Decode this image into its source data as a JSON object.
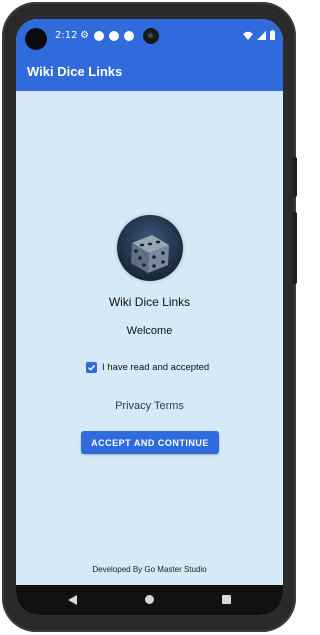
{
  "status_bar": {
    "time": "2:12",
    "icons": [
      "gear-icon",
      "notification-dot-icon",
      "notification-dot-icon",
      "notification-dot-icon",
      "wifi-icon",
      "signal-icon",
      "battery-icon"
    ]
  },
  "app_bar": {
    "title": "Wiki Dice Links"
  },
  "main": {
    "logo_icon": "dice-icon",
    "app_name": "Wiki Dice Links",
    "welcome_text": "Welcome",
    "consent_checkbox": {
      "checked": true,
      "label": "I have read and accepted"
    },
    "privacy_terms_link": "Privacy Terms",
    "accept_button_label": "ACCEPT AND CONTINUE",
    "footer": "Developed By Go Master Studio"
  },
  "nav_bar": {
    "icons": [
      "back-icon",
      "home-icon",
      "recents-icon"
    ]
  },
  "colors": {
    "primary": "#2f6bdc",
    "background": "#d6e9f7",
    "nav_bar": "#111111"
  }
}
